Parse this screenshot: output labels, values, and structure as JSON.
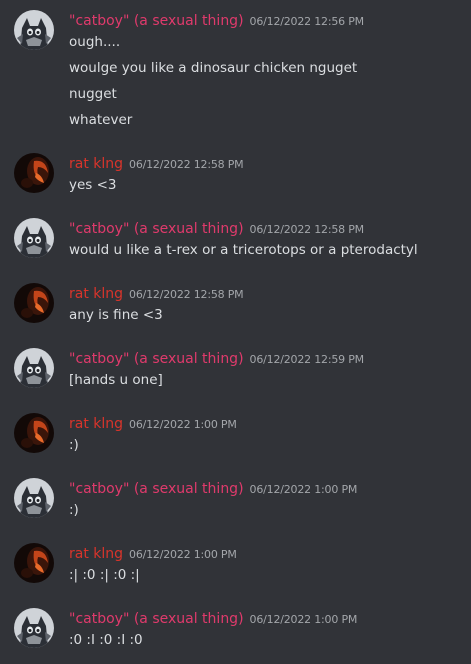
{
  "colors": {
    "background": "#313338",
    "catboy_name": "#e03a6c",
    "ratking_name": "#d9342b",
    "text": "#dbdee1",
    "timestamp": "#a3a6aa"
  },
  "messages": [
    {
      "author": "\"catboy\" (a sexual thing)",
      "timestamp": "06/12/2022 12:56 PM",
      "lines": [
        "ough....",
        "woulge you like a dinosaur chicken nguget",
        "nugget",
        "whatever"
      ]
    },
    {
      "author": "rat klng",
      "timestamp": "06/12/2022 12:58 PM",
      "lines": [
        "yes <3"
      ]
    },
    {
      "author": "\"catboy\" (a sexual thing)",
      "timestamp": "06/12/2022 12:58 PM",
      "lines": [
        "would u like a t-rex or a tricerotops or a pterodactyl"
      ]
    },
    {
      "author": "rat klng",
      "timestamp": "06/12/2022 12:58 PM",
      "lines": [
        "any is fine <3"
      ]
    },
    {
      "author": "\"catboy\" (a sexual thing)",
      "timestamp": "06/12/2022 12:59 PM",
      "lines": [
        "[hands u one]"
      ]
    },
    {
      "author": "rat klng",
      "timestamp": "06/12/2022 1:00 PM",
      "lines": [
        ":)"
      ]
    },
    {
      "author": "\"catboy\" (a sexual thing)",
      "timestamp": "06/12/2022 1:00 PM",
      "lines": [
        ":)"
      ]
    },
    {
      "author": "rat klng",
      "timestamp": "06/12/2022 1:00 PM",
      "lines": [
        ":| :0 :| :0 :|"
      ]
    },
    {
      "author": "\"catboy\" (a sexual thing)",
      "timestamp": "06/12/2022 1:00 PM",
      "lines": [
        ":0 :I :0 :I :0"
      ]
    }
  ]
}
